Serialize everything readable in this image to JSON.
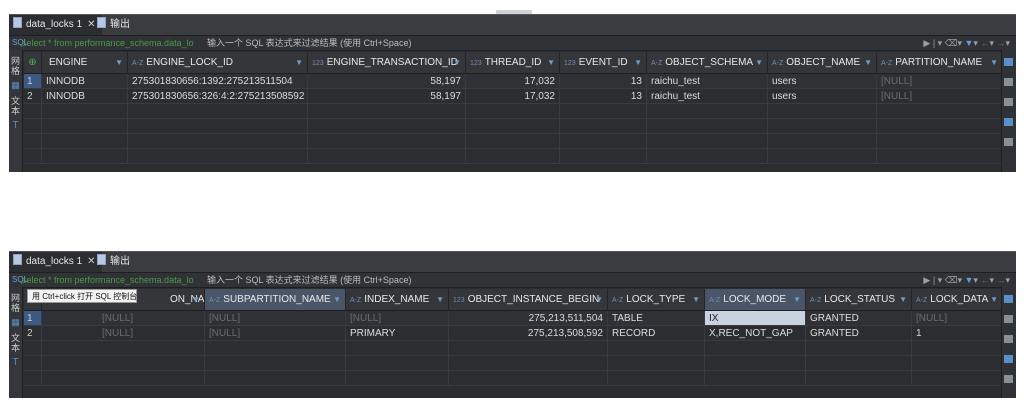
{
  "panel1": {
    "tabs": [
      {
        "label": "data_locks 1"
      },
      {
        "label": "输出"
      }
    ],
    "sql_text": "select * from performance_schema.data_lo",
    "filter_hint": "输入一个 SQL 表达式来过滤结果 (使用 Ctrl+Space)",
    "sidebar": [
      "网格",
      "文本"
    ],
    "columns": [
      {
        "type": "",
        "name": "ENGINE"
      },
      {
        "type": "A-Z",
        "name": "ENGINE_LOCK_ID"
      },
      {
        "type": "123",
        "name": "ENGINE_TRANSACTION_ID"
      },
      {
        "type": "123",
        "name": "THREAD_ID"
      },
      {
        "type": "123",
        "name": "EVENT_ID"
      },
      {
        "type": "A-Z",
        "name": "OBJECT_SCHEMA"
      },
      {
        "type": "A-Z",
        "name": "OBJECT_NAME"
      },
      {
        "type": "A-Z",
        "name": "PARTITION_NAME"
      }
    ],
    "rows": [
      {
        "no": "1",
        "cells": [
          "INNODB",
          "275301830656:1392:275213511504",
          "58,197",
          "17,032",
          "13",
          "raichu_test",
          "users",
          "[NULL]"
        ]
      },
      {
        "no": "2",
        "cells": [
          "INNODB",
          "275301830656:326:4:2:275213508592",
          "58,197",
          "17,032",
          "13",
          "raichu_test",
          "users",
          "[NULL]"
        ]
      }
    ]
  },
  "panel2": {
    "tabs": [
      {
        "label": "data_locks 1"
      },
      {
        "label": "输出"
      }
    ],
    "sql_text": "select * from performance_schema.data_lo",
    "filter_hint": "输入一个 SQL 表达式来过滤结果 (使用 Ctrl+Space)",
    "sidebar": [
      "网格",
      "文本"
    ],
    "tooltip": "用 Ctrl+click 打开 SQL 控制台",
    "columns": [
      {
        "type": "",
        "name": "ON_NAME"
      },
      {
        "type": "A-Z",
        "name": "SUBPARTITION_NAME"
      },
      {
        "type": "A-Z",
        "name": "INDEX_NAME"
      },
      {
        "type": "123",
        "name": "OBJECT_INSTANCE_BEGIN"
      },
      {
        "type": "A-Z",
        "name": "LOCK_TYPE"
      },
      {
        "type": "A-Z",
        "name": "LOCK_MODE"
      },
      {
        "type": "A-Z",
        "name": "LOCK_STATUS"
      },
      {
        "type": "A-Z",
        "name": "LOCK_DATA"
      }
    ],
    "rows": [
      {
        "no": "1",
        "cells": [
          "[NULL]",
          "[NULL]",
          "[NULL]",
          "275,213,511,504",
          "TABLE",
          "IX",
          "GRANTED",
          "[NULL]"
        ]
      },
      {
        "no": "2",
        "cells": [
          "[NULL]",
          "[NULL]",
          "PRIMARY",
          "275,213,508,592",
          "RECORD",
          "X,REC_NOT_GAP",
          "GRANTED",
          "1"
        ]
      }
    ]
  }
}
